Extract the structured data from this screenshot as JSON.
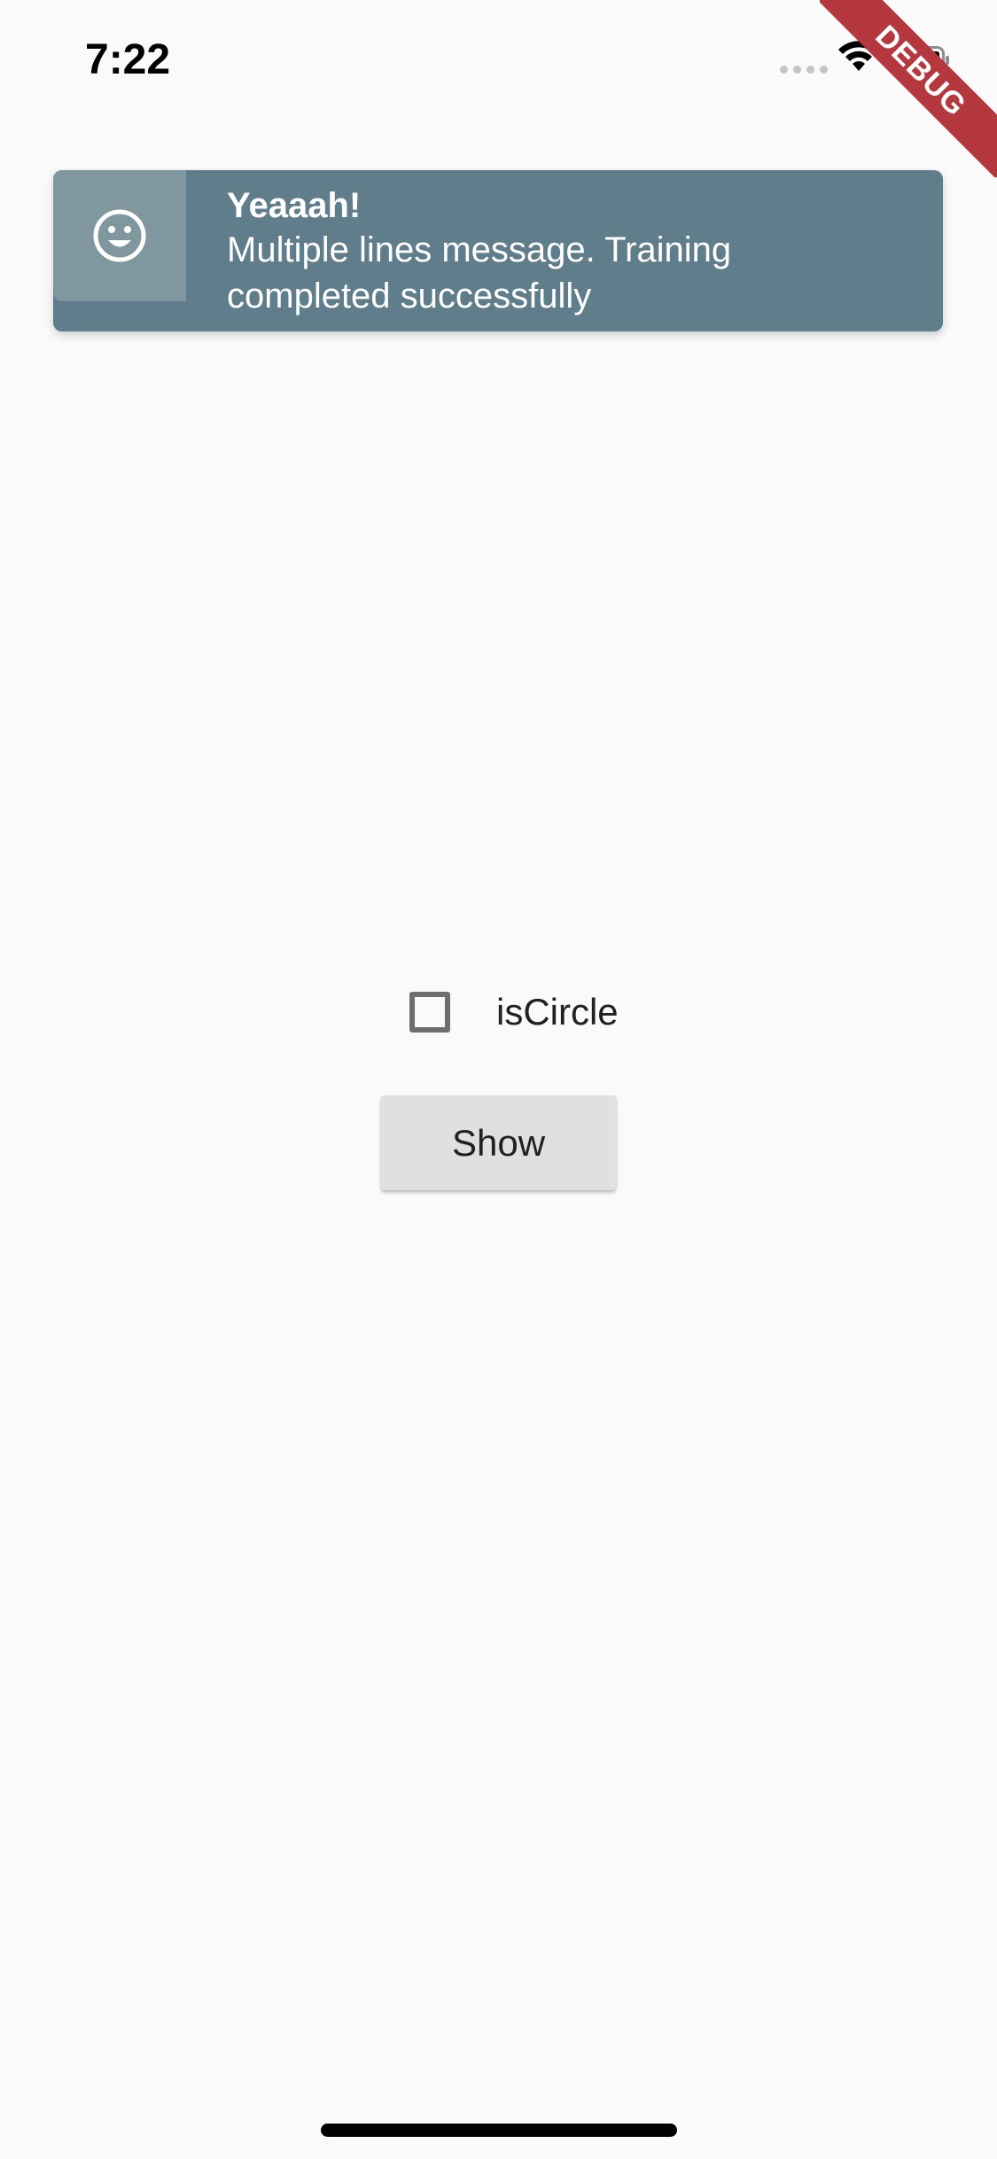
{
  "status_bar": {
    "time": "7:22",
    "icons": [
      "signal-icon",
      "wifi-icon",
      "battery-icon"
    ]
  },
  "debug_ribbon": {
    "label": "DEBUG",
    "color": "#b5383f"
  },
  "flash": {
    "icon": "smiley-face-icon",
    "title": "Yeaaah!",
    "message": "Multiple lines message. Training completed successfully",
    "background_color": "#607d8b",
    "icon_background_color": "#81979f"
  },
  "controls": {
    "checkbox_label": "isCircle",
    "checkbox_checked": false,
    "show_button_label": "Show"
  }
}
